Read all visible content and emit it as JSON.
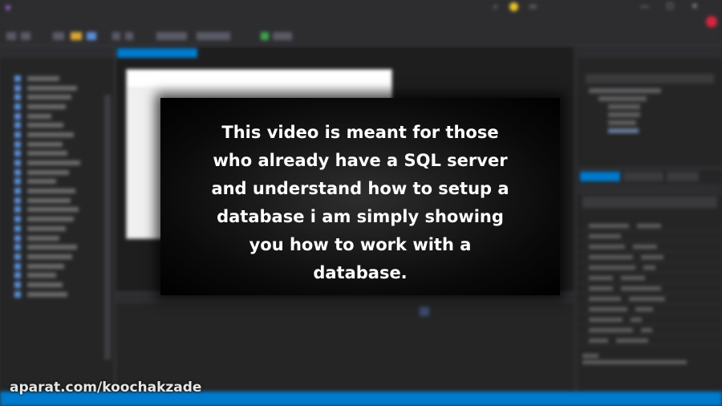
{
  "caption": {
    "text": "This video is meant for those\nwho already have a SQL server\nand understand how to setup a\ndatabase i am simply showing\nyou how to work with a\ndatabase."
  },
  "watermark": {
    "text": "aparat.com/koochakzade"
  },
  "colors": {
    "accent": "#007acc",
    "ide_background": "#2d2d30",
    "overlay": "#000000",
    "caption_text": "#ffffff"
  }
}
